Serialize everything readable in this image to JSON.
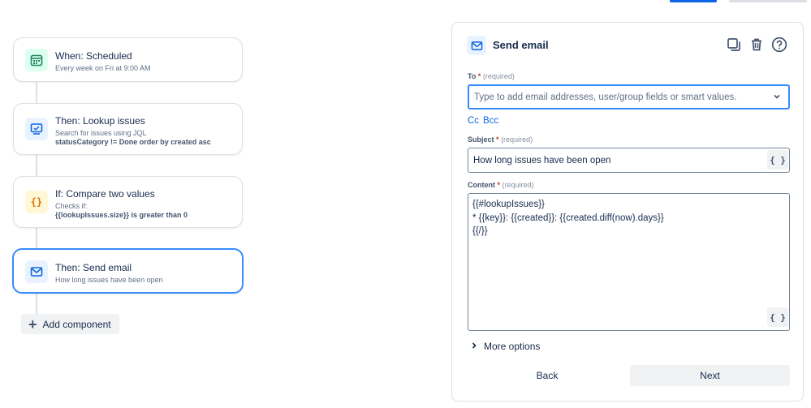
{
  "flow": {
    "nodes": [
      {
        "title": "When: Scheduled",
        "sub": "Every week on Fri at 9:00 AM",
        "icon": "calendar-icon",
        "color": "#1f845a"
      },
      {
        "title": "Then: Lookup issues",
        "sub": "Search for issues using JQL",
        "sub2": "statusCategory != Done order by created asc",
        "icon": "monitor-icon",
        "color": "#0c66e4"
      },
      {
        "title": "If: Compare two values",
        "sub": "Checks if:",
        "sub2": "{{lookupIssues.size}} is greater than 0",
        "icon": "braces-icon",
        "color": "#d97008"
      },
      {
        "title": "Then: Send email",
        "sub": "How long issues have been open",
        "icon": "mail-icon",
        "color": "#0c66e4"
      }
    ],
    "add_component": "Add component"
  },
  "panel": {
    "title": "Send email",
    "to": {
      "label": "To",
      "required": "(required)",
      "placeholder": "Type to add email addresses, user/group fields or smart values."
    },
    "cc": "Cc",
    "bcc": "Bcc",
    "subject": {
      "label": "Subject",
      "required": "(required)",
      "value": "How long issues have been open",
      "smart_button": "{ }"
    },
    "content": {
      "label": "Content",
      "required": "(required)",
      "lines": [
        "{{#lookupIssues}}",
        "* {{key}}: {{created}}: {{created.diff(now).days}}",
        "{{/}}"
      ],
      "smart_button": "{ }"
    },
    "more_options": "More options",
    "back": "Back",
    "next": "Next"
  },
  "colors": {
    "accent": "#0c66e4",
    "focus": "#388bff",
    "required_star": "#c9372c"
  }
}
